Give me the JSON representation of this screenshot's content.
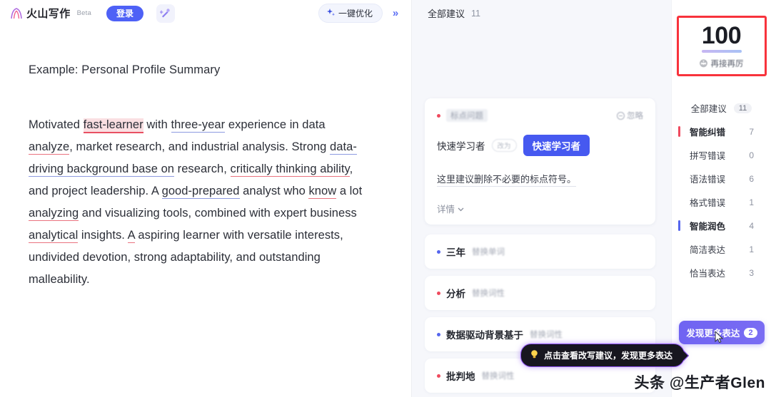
{
  "header": {
    "brand_name": "火山写作",
    "beta_badge": "Beta",
    "login_label": "登录",
    "wand_icon": "magic-wand-icon",
    "optimize_label": "一键优化",
    "optimize_icon": "sparkle-icon",
    "collapse_icon": "»"
  },
  "document": {
    "title": "Example: Personal Profile Summary",
    "paragraph_parts": [
      {
        "text": "Motivated ",
        "mark": "none"
      },
      {
        "text": "fast-learner",
        "mark": "red-highlight"
      },
      {
        "text": " with ",
        "mark": "none"
      },
      {
        "text": "three-year",
        "mark": "blue-underline"
      },
      {
        "text": " experience in data ",
        "mark": "none"
      },
      {
        "text": "analyze",
        "mark": "red-underline"
      },
      {
        "text": ", market research, and industrial analysis. Strong ",
        "mark": "none"
      },
      {
        "text": "data-driving background base on",
        "mark": "blue-underline"
      },
      {
        "text": " research, ",
        "mark": "none"
      },
      {
        "text": "critically thinking ability",
        "mark": "red-underline"
      },
      {
        "text": ", and project leadership. A ",
        "mark": "none"
      },
      {
        "text": "good-prepared",
        "mark": "blue-underline"
      },
      {
        "text": " analyst who ",
        "mark": "none"
      },
      {
        "text": "know",
        "mark": "red-underline"
      },
      {
        "text": " a lot ",
        "mark": "none"
      },
      {
        "text": "analyzing",
        "mark": "red-underline"
      },
      {
        "text": " and visualizing tools, combined with expert business ",
        "mark": "none"
      },
      {
        "text": "analytical",
        "mark": "red-underline"
      },
      {
        "text": " insights. ",
        "mark": "none"
      },
      {
        "text": "A",
        "mark": "red-underline"
      },
      {
        "text": " aspiring learner with versatile interests, undivided devotion, strong adaptability, and outstanding malleability.",
        "mark": "none"
      }
    ]
  },
  "suggestions": {
    "header_title": "全部建议",
    "header_count": "11",
    "card": {
      "tag_label": "标点问题",
      "tag_color": "red",
      "ignore_label": "忽略",
      "ignore_icon": "minus-circle-icon",
      "original": "快速学习者",
      "arrow_chip": "改为",
      "replacement": "快速学习者",
      "description": "这里建议删除不必要的标点符号。",
      "more_label": "详情",
      "more_icon": "chevron-down-icon"
    },
    "rows": [
      {
        "word": "三年",
        "kind": "替换单词",
        "dot": "blue"
      },
      {
        "word": "分析",
        "kind": "替换词性",
        "dot": "red"
      },
      {
        "word": "数据驱动背景基于",
        "kind": "替换词性",
        "dot": "blue"
      },
      {
        "word": "批判地",
        "kind": "替换词性",
        "dot": "red"
      }
    ],
    "tooltip": {
      "icon": "lightbulb-icon",
      "text": "点击查看改写建议，发现更多表达"
    }
  },
  "sidebar": {
    "score": "100",
    "score_label": "再接再厉",
    "score_emoji": "😊",
    "all_label": "全部建议",
    "all_count": "11",
    "categories": [
      {
        "name": "智能纠错",
        "count": "7",
        "accent": "red",
        "group": true
      },
      {
        "name": "拼写错误",
        "count": "0",
        "accent": "none",
        "group": false
      },
      {
        "name": "语法错误",
        "count": "6",
        "accent": "none",
        "group": false
      },
      {
        "name": "格式错误",
        "count": "1",
        "accent": "none",
        "group": false
      },
      {
        "name": "智能润色",
        "count": "4",
        "accent": "blue",
        "group": true
      },
      {
        "name": "简洁表达",
        "count": "1",
        "accent": "none",
        "group": false
      },
      {
        "name": "恰当表达",
        "count": "3",
        "accent": "none",
        "group": false
      }
    ],
    "discover_label": "发现更多表达",
    "discover_count": "2"
  },
  "watermark": "头条 @生产者Glen",
  "colors": {
    "accent_blue": "#4e61f6",
    "accent_purple": "#6f63f2",
    "error_red": "#ef4a5e",
    "annotation_red": "#f8333c"
  }
}
